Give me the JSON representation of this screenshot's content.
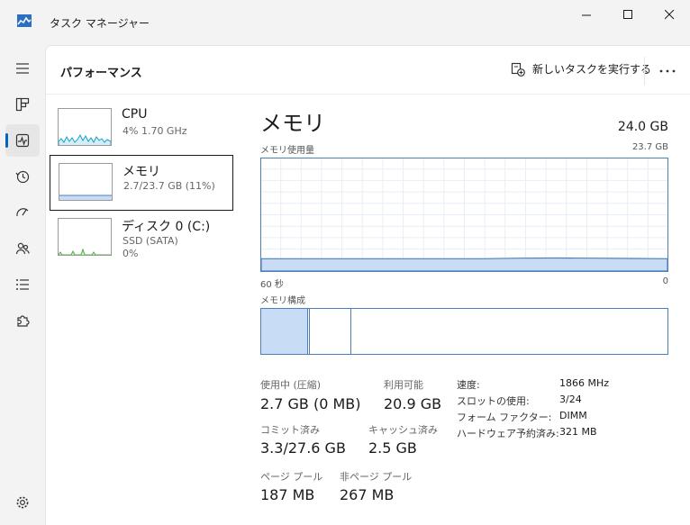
{
  "window": {
    "title": "タスク マネージャー"
  },
  "header": {
    "title": "パフォーマンス",
    "run_task_label": "新しいタスクを実行する"
  },
  "cards": [
    {
      "name": "CPU",
      "sub1": "4%  1.70 GHz"
    },
    {
      "name": "メモリ",
      "sub1": "2.7/23.7 GB (11%)"
    },
    {
      "name": "ディスク 0 (C:)",
      "sub1": "SSD (SATA)",
      "sub2": "0%"
    }
  ],
  "memory": {
    "title": "メモリ",
    "total": "24.0 GB",
    "usage_label": "メモリ使用量",
    "usage_max": "23.7 GB",
    "axis_left": "60 秒",
    "axis_right": "0",
    "composition_label": "メモリ構成",
    "usage_fraction": 0.11
  },
  "stats": {
    "in_use_label": "使用中 (圧縮)",
    "in_use_value": "2.7 GB (0 MB)",
    "available_label": "利用可能",
    "available_value": "20.9 GB",
    "committed_label": "コミット済み",
    "committed_value": "3.3/27.6 GB",
    "cached_label": "キャッシュ済み",
    "cached_value": "2.5 GB",
    "paged_label": "ページ プール",
    "paged_value": "187 MB",
    "nonpaged_label": "非ページ プール",
    "nonpaged_value": "267 MB"
  },
  "info": [
    {
      "key": "速度:",
      "value": "1866 MHz"
    },
    {
      "key": "スロットの使用:",
      "value": "3/24"
    },
    {
      "key": "フォーム ファクター:",
      "value": "DIMM"
    },
    {
      "key": "ハードウェア予約済み:",
      "value": "321 MB"
    }
  ],
  "colors": {
    "accent": "#0067c0",
    "memory_line": "#4d7fb8",
    "memory_fill": "#c8ddf5",
    "cpu_line": "#17a0c8",
    "disk_line": "#4caf3a"
  }
}
